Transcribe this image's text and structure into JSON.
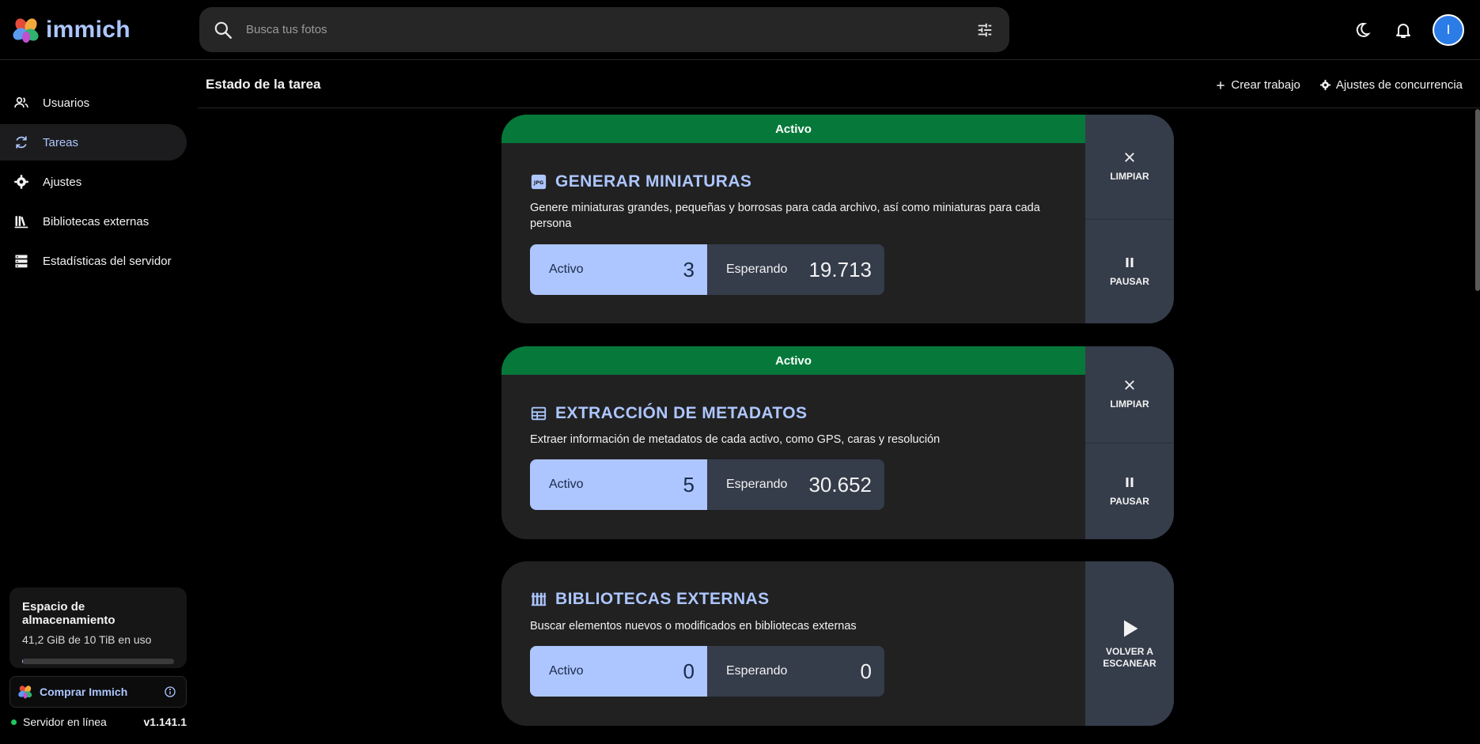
{
  "app": {
    "name": "immich"
  },
  "search": {
    "placeholder": "Busca tus fotos"
  },
  "user": {
    "initial": "I"
  },
  "sidebar": {
    "items": [
      {
        "label": "Usuarios",
        "icon": "users-icon"
      },
      {
        "label": "Tareas",
        "icon": "sync-icon",
        "active": true
      },
      {
        "label": "Ajustes",
        "icon": "gear-icon"
      },
      {
        "label": "Bibliotecas externas",
        "icon": "library-icon"
      },
      {
        "label": "Estadísticas del servidor",
        "icon": "server-icon"
      }
    ],
    "storage": {
      "title": "Espacio de almacenamiento",
      "usage": "41,2 GiB de 10 TiB en uso",
      "used_fraction": 0.004
    },
    "buy_label": "Comprar Immich",
    "server_status": "Servidor en línea",
    "version": "v1.141.1"
  },
  "header": {
    "title": "Estado de la tarea",
    "create_job": "Crear trabajo",
    "concurrency": "Ajustes de concurrencia"
  },
  "jobs": [
    {
      "status": "Activo",
      "title": "GENERAR MINIATURAS",
      "description": "Genere miniaturas grandes, pequeñas y borrosas para cada archivo, así como miniaturas para cada persona",
      "active_label": "Activo",
      "active_count": "3",
      "waiting_label": "Esperando",
      "waiting_count": "19.713",
      "btn_clear": "LIMPIAR",
      "btn_pause": "PAUSAR"
    },
    {
      "status": "Activo",
      "title": "EXTRACCIÓN DE METADATOS",
      "description": "Extraer información de metadatos de cada activo, como GPS, caras y resolución",
      "active_label": "Activo",
      "active_count": "5",
      "waiting_label": "Esperando",
      "waiting_count": "30.652",
      "btn_clear": "LIMPIAR",
      "btn_pause": "PAUSAR"
    },
    {
      "title": "BIBLIOTECAS EXTERNAS",
      "description": "Buscar elementos nuevos o modificados en bibliotecas externas",
      "active_label": "Activo",
      "active_count": "0",
      "waiting_label": "Esperando",
      "waiting_count": "0",
      "btn_rescan_line1": "VOLVER A",
      "btn_rescan_line2": "ESCANEAR"
    }
  ]
}
